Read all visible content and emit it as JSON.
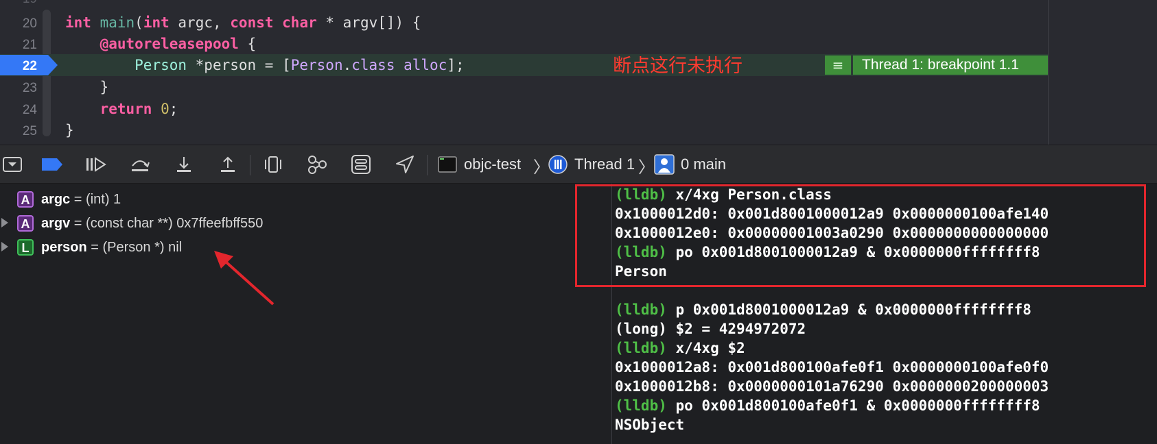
{
  "editor": {
    "lines": [
      {
        "num": "20"
      },
      {
        "num": "21"
      },
      {
        "num": "22"
      },
      {
        "num": "23"
      },
      {
        "num": "24"
      },
      {
        "num": "25"
      }
    ],
    "top_partial_line": "19",
    "annotation": "断点这行未执行",
    "thread_label": "Thread 1: breakpoint 1.1",
    "colors": {
      "breakpoint": "#3478f6",
      "highlight": "#2b3b35",
      "thread_badge": "#3f8f3a",
      "annotation": "#ff3b30"
    }
  },
  "toolbar": {
    "icons": [
      "hide-debug-area-icon",
      "breakpoint-toggle-icon",
      "continue-icon",
      "step-over-icon",
      "step-into-icon",
      "step-out-icon",
      "view-hierarchy-icon",
      "memory-graph-icon",
      "environment-overrides-icon",
      "simulate-location-icon"
    ],
    "breadcrumb": {
      "target": "objc-test",
      "thread": "Thread 1",
      "frame": "0 main"
    }
  },
  "variables": [
    {
      "badge": "A",
      "name": "argc",
      "value": " = (int) 1",
      "expandable": false
    },
    {
      "badge": "A",
      "name": "argv",
      "value": " = (const char **) 0x7ffeefbff550",
      "expandable": true
    },
    {
      "badge": "L",
      "name": "person",
      "value": " = (Person *) nil",
      "expandable": true
    }
  ],
  "console": [
    {
      "prompt": "(lldb)",
      "text": " x/4xg Person.class"
    },
    {
      "prompt": "",
      "text": "0x1000012d0: 0x001d8001000012a9 0x0000000100afe140"
    },
    {
      "prompt": "",
      "text": "0x1000012e0: 0x00000001003a0290 0x0000000000000000"
    },
    {
      "prompt": "(lldb)",
      "text": " po 0x001d8001000012a9 & 0x0000000ffffffff8"
    },
    {
      "prompt": "",
      "text": "Person"
    },
    {
      "prompt": "",
      "text": ""
    },
    {
      "prompt": "(lldb)",
      "text": " p 0x001d8001000012a9 & 0x0000000ffffffff8"
    },
    {
      "prompt": "",
      "text": "(long) $2 = 4294972072"
    },
    {
      "prompt": "(lldb)",
      "text": " x/4xg $2"
    },
    {
      "prompt": "",
      "text": "0x1000012a8: 0x001d800100afe0f1 0x0000000100afe0f0"
    },
    {
      "prompt": "",
      "text": "0x1000012b8: 0x0000000101a76290 0x0000000200000003"
    },
    {
      "prompt": "(lldb)",
      "text": " po 0x001d800100afe0f1 & 0x0000000ffffffff8"
    },
    {
      "prompt": "",
      "text": "NSObject"
    }
  ]
}
